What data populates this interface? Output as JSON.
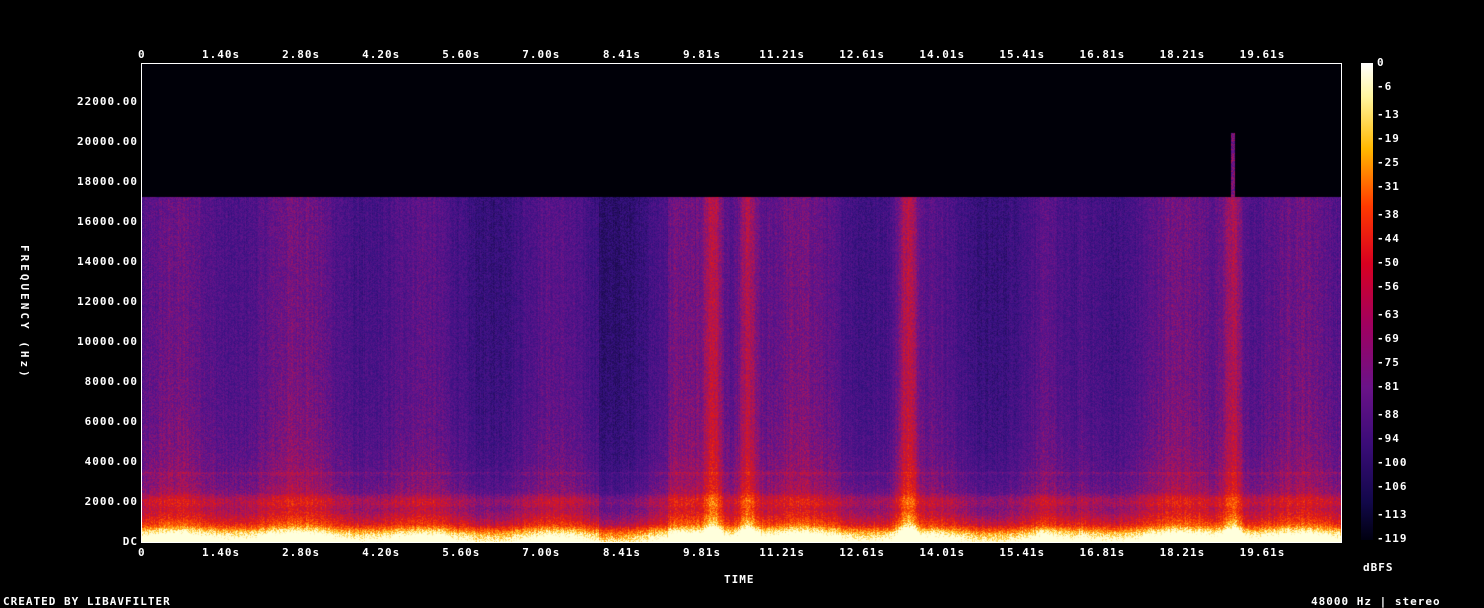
{
  "chart_data": {
    "type": "heatmap",
    "title": "",
    "xlabel": "TIME",
    "ylabel": "FREQUENCY (Hz)",
    "x_tick_labels": [
      "0",
      "1.40s",
      "2.80s",
      "4.20s",
      "5.60s",
      "7.00s",
      "8.41s",
      "9.81s",
      "11.21s",
      "12.61s",
      "14.01s",
      "15.41s",
      "16.81s",
      "18.21s",
      "19.61s"
    ],
    "x_tick_values": [
      0,
      1.4,
      2.8,
      4.2,
      5.6,
      7.0,
      8.41,
      9.81,
      11.21,
      12.61,
      14.01,
      15.41,
      16.81,
      18.21,
      19.61
    ],
    "xlim": [
      0,
      21.0
    ],
    "y_tick_labels": [
      "DC",
      "2000.00",
      "4000.00",
      "6000.00",
      "8000.00",
      "10000.00",
      "12000.00",
      "14000.00",
      "16000.00",
      "18000.00",
      "20000.00",
      "22000.00"
    ],
    "y_tick_values": [
      0,
      2000,
      4000,
      6000,
      8000,
      10000,
      12000,
      14000,
      16000,
      18000,
      20000,
      22000
    ],
    "ylim": [
      0,
      24000
    ],
    "colorbar": {
      "unit": "dBFS",
      "labels": [
        "0",
        "-6",
        "-13",
        "-19",
        "-25",
        "-31",
        "-38",
        "-44",
        "-50",
        "-56",
        "-63",
        "-69",
        "-75",
        "-81",
        "-88",
        "-94",
        "-100",
        "-106",
        "-113",
        "-119"
      ],
      "values": [
        0,
        -6,
        -13,
        -19,
        -25,
        -31,
        -38,
        -44,
        -50,
        -56,
        -63,
        -69,
        -75,
        -81,
        -88,
        -94,
        -100,
        -106,
        -113,
        -119
      ],
      "range": [
        -119,
        0
      ]
    },
    "content_cutoff_hz": 17250,
    "bright_time_bands_s": [
      10.0,
      10.6,
      13.4,
      19.1
    ],
    "colors": {
      "background": "#000000",
      "low": "#160a40",
      "mid": "#5a1a9a",
      "high": "#ff2000",
      "peak": "#ffffe0"
    }
  },
  "footer": {
    "left": "CREATED BY LIBAVFILTER",
    "right": "48000 Hz | stereo"
  }
}
